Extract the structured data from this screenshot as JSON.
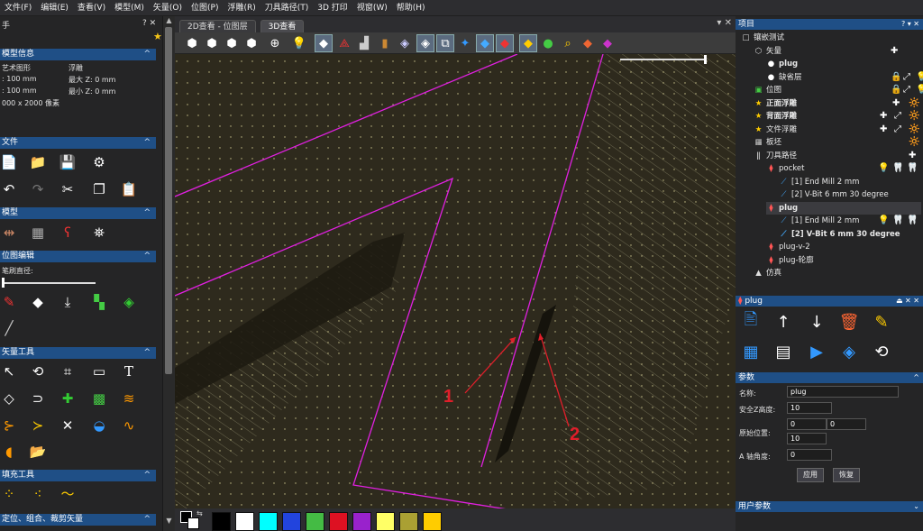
{
  "menu": [
    "文件(F)",
    "编辑(E)",
    "查看(V)",
    "模型(M)",
    "矢量(O)",
    "位图(P)",
    "浮雕(R)",
    "刀具路径(T)",
    "3D 打印",
    "视窗(W)",
    "帮助(H)"
  ],
  "left_panel": {
    "title": "手",
    "model_info": {
      "header": "模型信息",
      "col1_label": "艺术图形",
      "col2_label": "浮雕",
      "r1c1": ": 100 mm",
      "r1c2": "最大 Z: 0 mm",
      "r2c1": ": 100 mm",
      "r2c2": "最小 Z: 0 mm",
      "r3c1": "000 x 2000 像素"
    },
    "file_header": "文件",
    "model_header": "模型",
    "bitmap_header": "位图编辑",
    "brush_label": "笔刷直径:",
    "vector_header": "矢量工具",
    "fill_header": "填充工具",
    "position_header": "定位、组合、裁剪矢量"
  },
  "viewport": {
    "tabs": [
      "2D查看 - 位图层",
      "3D查看"
    ],
    "active_tab": "3D查看",
    "annotations": [
      {
        "label": "1"
      },
      {
        "label": "2"
      }
    ],
    "path_color": "#e020e0",
    "annotation_color": "#e01e2a"
  },
  "palette": [
    "#000000",
    "#ffffff",
    "#00ffff",
    "#2244dd",
    "#44bb44",
    "#dd1122",
    "#9922cc",
    "#ffff66",
    "#aaa033",
    "#ffcc00"
  ],
  "project": {
    "header": "项目",
    "tree": [
      {
        "label": "镶嵌测试",
        "indent": 0,
        "icon": "□"
      },
      {
        "label": "矢量",
        "indent": 1,
        "icon": "⬡"
      },
      {
        "label": "plug",
        "indent": 2,
        "icon": "●",
        "bold": true
      },
      {
        "label": "缺省层",
        "indent": 2,
        "icon": "●"
      },
      {
        "label": "位图",
        "indent": 1,
        "icon": "▣"
      },
      {
        "label": "正面浮雕",
        "indent": 1,
        "icon": "★",
        "bold": true
      },
      {
        "label": "背面浮雕",
        "indent": 1,
        "icon": "★",
        "bold": true
      },
      {
        "label": "文件浮雕",
        "indent": 1,
        "icon": "★"
      },
      {
        "label": "板坯",
        "indent": 1,
        "icon": "▦"
      },
      {
        "label": "刀具路径",
        "indent": 1,
        "icon": "ǁ"
      },
      {
        "label": "pocket",
        "indent": 2,
        "icon": "⧫"
      },
      {
        "label": "[1] End Mill 2 mm",
        "indent": 3,
        "icon": "⟋"
      },
      {
        "label": "[2] V-Bit 6 mm 30 degree",
        "indent": 3,
        "icon": "⟋"
      },
      {
        "label": "plug",
        "indent": 2,
        "icon": "⧫",
        "bold": true
      },
      {
        "label": "[1] End Mill 2 mm",
        "indent": 3,
        "icon": "⟋"
      },
      {
        "label": "[2] V-Bit 6 mm 30 degree",
        "indent": 3,
        "icon": "⟋",
        "bold": true
      },
      {
        "label": "plug-v-2",
        "indent": 2,
        "icon": "⧫"
      },
      {
        "label": "plug-轮廓",
        "indent": 2,
        "icon": "⧫"
      },
      {
        "label": "仿真",
        "indent": 1,
        "icon": "▲"
      }
    ]
  },
  "toolpath_panel": {
    "header": "plug",
    "params_header": "参数",
    "name_label": "名称:",
    "name_value": "plug",
    "safez_label": "安全Z高度:",
    "safez_value": "10",
    "origin_label": "原始位置:",
    "origin_x": "0",
    "origin_y": "0",
    "origin_z": "10",
    "a_axis_label": "A 轴角度:",
    "a_axis_value": "0",
    "apply_label": "应用",
    "restore_label": "恢复",
    "user_params_header": "用户参数"
  }
}
